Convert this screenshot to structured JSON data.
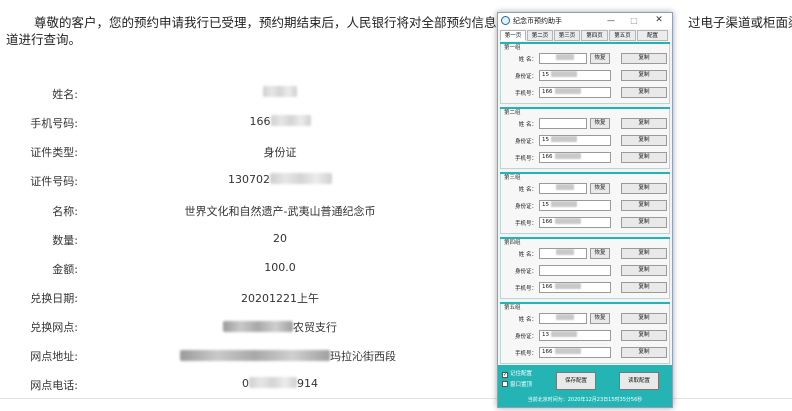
{
  "page": {
    "intro_line1": "尊敬的客户，您的预约申请我行已受理，预约期结束后，人民银行将对全部预约信息进",
    "intro_line1_tail": "过电子渠道或柜面渠",
    "intro_line2": "道进行查询。",
    "rows": [
      {
        "label": "姓名:",
        "value": "",
        "blur_width": 34
      },
      {
        "label": "手机号码:",
        "value": "166",
        "blur_width": 40
      },
      {
        "label": "证件类型:",
        "value": "身份证",
        "blur_width": 0
      },
      {
        "label": "证件号码:",
        "value": "130702",
        "blur_width": 62
      },
      {
        "label": "名称:",
        "value": "世界文化和自然遗产-武夷山普通纪念币",
        "blur_width": 0
      },
      {
        "label": "数量:",
        "value": "20",
        "blur_width": 0
      },
      {
        "label": "金额:",
        "value": "100.0",
        "blur_width": 0
      },
      {
        "label": "兑换日期:",
        "value": "20201221上午",
        "blur_width": 0
      },
      {
        "label": "兑换网点:",
        "value": "农贸支行",
        "blur_width": 70,
        "blur_first": true
      },
      {
        "label": "网点地址:",
        "value": "玛拉沁街西段",
        "blur_width": 150,
        "blur_first": true
      },
      {
        "label": "网点电话:",
        "value": "914",
        "blur_width": 48,
        "prefix": "0"
      }
    ]
  },
  "window": {
    "title": "纪念币预约助手",
    "controls": {
      "minimize": "—",
      "maximize": "□",
      "close": "✕"
    },
    "tabs": [
      "第一页",
      "第二页",
      "第三页",
      "第四页",
      "第五页",
      "配置"
    ],
    "active_tab": 0,
    "labels": {
      "name": "姓  名：",
      "id": "身份证：",
      "phone": "手机号："
    },
    "restore_label": "恢复",
    "copy_label": "复制",
    "groups": [
      {
        "title": "第一组",
        "id_prefix": "15",
        "phone_prefix": "166"
      },
      {
        "title": "第二组",
        "id_prefix": "15",
        "phone_prefix": "166"
      },
      {
        "title": "第三组",
        "id_prefix": "15",
        "phone_prefix": "166"
      },
      {
        "title": "第四组",
        "id_prefix": "",
        "phone_prefix": "166"
      },
      {
        "title": "第五组",
        "id_prefix": "13",
        "phone_prefix": "166"
      }
    ],
    "footer": {
      "checkbox1_label": "记住配置",
      "checkbox1_checked": true,
      "checkbox2_label": "窗口置顶",
      "checkbox2_checked": false,
      "save_label": "保存配置",
      "load_label": "读取配置",
      "status": "当前北京时间为：2020年12月23日15时35分56秒"
    }
  },
  "colors": {
    "accent": "#25b4b4",
    "border": "#8aa1b8"
  }
}
